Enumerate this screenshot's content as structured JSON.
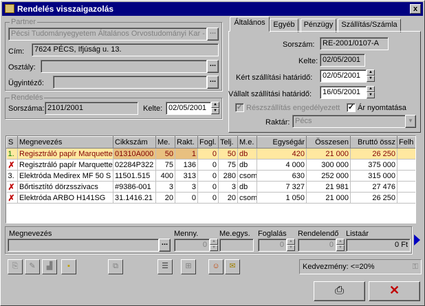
{
  "window": {
    "title": "Rendelés visszaigazolás",
    "close": "x"
  },
  "partner": {
    "group_title": "Partner",
    "name": "Pécsi Tudományegyetem Általános Orvostudományi Kar - Sz",
    "cim_label": "Cím:",
    "cim": "7624 PÉCS, Ifjúság u. 13.",
    "osztaly_label": "Osztály:",
    "osztaly": "",
    "ugyintezo_label": "Ügyintéző:",
    "ugyintezo": "",
    "dots": "..."
  },
  "rendeles": {
    "group_title": "Rendelés",
    "sorszama_label": "Sorszáma:",
    "sorszama": "2101/2001",
    "kelte_label": "Kelte:",
    "kelte": "02/05/2001"
  },
  "tabs": [
    {
      "label": "Általános"
    },
    {
      "label": "Egyéb"
    },
    {
      "label": "Pénzügy"
    },
    {
      "label": "Szállítás/Számla"
    }
  ],
  "general": {
    "sorszam_label": "Sorszám:",
    "sorszam": "RE-2001/0107-A",
    "kelte_label": "Kelte:",
    "kelte": "02/05/2001",
    "kert_label": "Kért szállítási határidő:",
    "kert": "02/05/2001",
    "vallalt_label": "Vállalt szállítási határidő:",
    "vallalt": "16/05/2001",
    "reszszallitas_label": "Részszállítás engedélyezett",
    "reszszallitas_checked": "✓",
    "ar_label": "Ár nyomtatása",
    "ar_checked": "✓",
    "raktar_label": "Raktár:",
    "raktar": "Pécs"
  },
  "table": {
    "columns": [
      "S",
      "Megnevezés",
      "Cikkszám",
      "Me.",
      "Rakt.",
      "Fogl.",
      "Telj.",
      "M.e.",
      "Egységár",
      "Összesen",
      "Bruttó össz",
      "Felh"
    ],
    "rows": [
      {
        "s": "1.",
        "name": "Regisztráló papír Marquette",
        "code": "01310A000",
        "me": "50",
        "rakt": "1",
        "fogl": "0",
        "telj": "50",
        "unit": "db",
        "price": "420",
        "total": "21 000",
        "gross": "26 250",
        "felh": ""
      },
      {
        "s": "✗",
        "name": "Regisztráló papír Marquette",
        "code": "02284P322",
        "me": "75",
        "rakt": "136",
        "fogl": "0",
        "telj": "75",
        "unit": "db",
        "price": "4 000",
        "total": "300 000",
        "gross": "375 000",
        "felh": ""
      },
      {
        "s": "3.",
        "name": "Elektróda Medirex MF 50 S",
        "code": "11501.515",
        "me": "400",
        "rakt": "313",
        "fogl": "0",
        "telj": "280",
        "unit": "csom",
        "price": "630",
        "total": "252 000",
        "gross": "315 000",
        "felh": ""
      },
      {
        "s": "✗",
        "name": "Bőrtisztító dörzsszivacs",
        "code": "#9386-001",
        "me": "3",
        "rakt": "3",
        "fogl": "0",
        "telj": "3",
        "unit": "db",
        "price": "7 327",
        "total": "21 981",
        "gross": "27 476",
        "felh": ""
      },
      {
        "s": "✗",
        "name": "Elektróda ARBO H141SG",
        "code": "31.1416.21",
        "me": "20",
        "rakt": "0",
        "fogl": "0",
        "telj": "20",
        "unit": "csom",
        "price": "1 050",
        "total": "21 000",
        "gross": "26 250",
        "felh": ""
      }
    ]
  },
  "editor": {
    "megnevezes_label": "Megnevezés",
    "menny_label": "Menny.",
    "menny": "0",
    "meegys_label": "Me.egys.",
    "foglalas_label": "Foglalás",
    "foglalas": "0",
    "rendelendo_label": "Rendelendő",
    "rendelendo": "0",
    "listaar_label": "Listaár",
    "listaar": "0 Ft"
  },
  "status": {
    "kedvezmeny": "Kedvezmény: <=20%"
  },
  "colors": {
    "title_bar": "#000080",
    "selected_row": "#ffe8a0",
    "cancel": "#c00000"
  }
}
